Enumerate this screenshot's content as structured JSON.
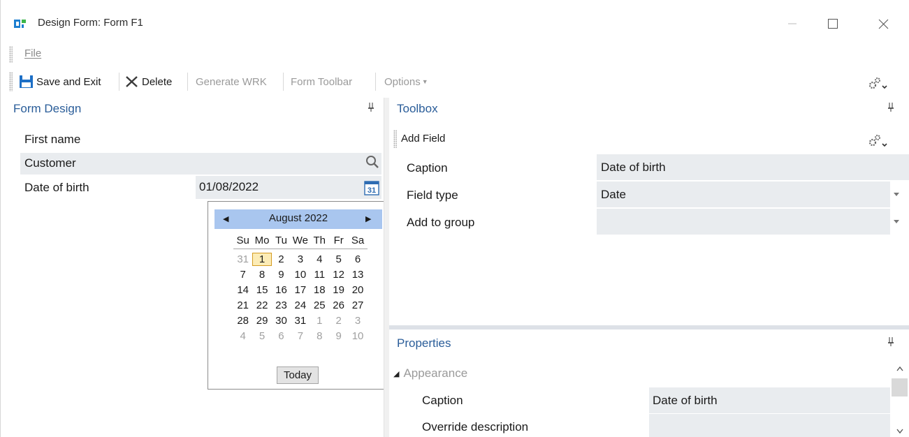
{
  "window": {
    "title": "Design Form: Form F1",
    "icon": "app-logo-icon"
  },
  "menu": {
    "file": "File"
  },
  "toolbar": {
    "save_and_exit": "Save and Exit",
    "delete": "Delete",
    "generate_wrk": "Generate WRK",
    "form_toolbar": "Form Toolbar",
    "options": "Options"
  },
  "form_design": {
    "title": "Form Design",
    "rows": [
      {
        "label": "First name",
        "value": ""
      },
      {
        "label": "Customer",
        "value": ""
      },
      {
        "label": "Date of birth",
        "value": "01/08/2022"
      }
    ]
  },
  "calendar": {
    "month_label": "August 2022",
    "weekdays": [
      "Su",
      "Mo",
      "Tu",
      "We",
      "Th",
      "Fr",
      "Sa"
    ],
    "weeks": [
      [
        "31",
        "1",
        "2",
        "3",
        "4",
        "5",
        "6"
      ],
      [
        "7",
        "8",
        "9",
        "10",
        "11",
        "12",
        "13"
      ],
      [
        "14",
        "15",
        "16",
        "17",
        "18",
        "19",
        "20"
      ],
      [
        "21",
        "22",
        "23",
        "24",
        "25",
        "26",
        "27"
      ],
      [
        "28",
        "29",
        "30",
        "31",
        "1",
        "2",
        "3"
      ],
      [
        "4",
        "5",
        "6",
        "7",
        "8",
        "9",
        "10"
      ]
    ],
    "selected_day": "1",
    "today_label": "Today"
  },
  "toolbox": {
    "title": "Toolbox",
    "add_field": "Add Field",
    "rows": [
      {
        "label": "Caption",
        "value": "Date of birth"
      },
      {
        "label": "Field type",
        "value": "Date"
      },
      {
        "label": "Add to group",
        "value": ""
      }
    ]
  },
  "properties": {
    "title": "Properties",
    "section": "Appearance",
    "rows": [
      {
        "label": "Caption",
        "value": "Date of birth"
      },
      {
        "label": "Override description",
        "value": ""
      }
    ]
  },
  "colors": {
    "accent": "#2a5d99",
    "calendar_header": "#a9c6ef",
    "selected_day_border": "#d49b21",
    "field_background": "#e9ecef"
  }
}
